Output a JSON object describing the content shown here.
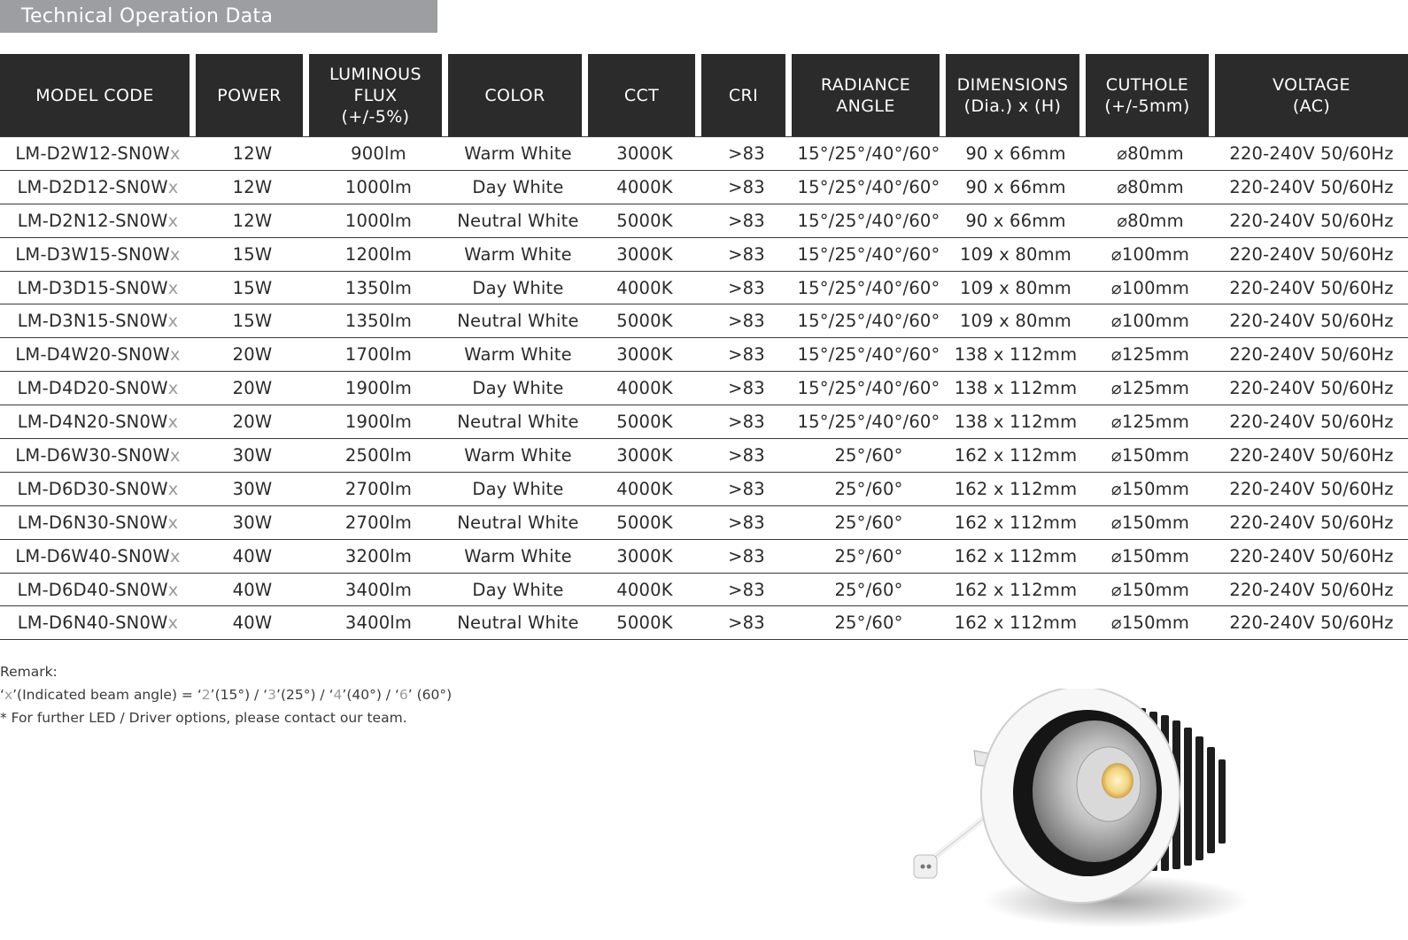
{
  "title": "Technical Operation Data",
  "table": {
    "headers": [
      {
        "line1": "MODEL CODE",
        "line2": "",
        "line3": ""
      },
      {
        "line1": "POWER",
        "line2": "",
        "line3": ""
      },
      {
        "line1": "LUMINOUS",
        "line2": "FLUX",
        "line3": "(+/-5%)"
      },
      {
        "line1": "COLOR",
        "line2": "",
        "line3": ""
      },
      {
        "line1": "CCT",
        "line2": "",
        "line3": ""
      },
      {
        "line1": "CRI",
        "line2": "",
        "line3": ""
      },
      {
        "line1": "RADIANCE",
        "line2": "ANGLE",
        "line3": ""
      },
      {
        "line1": "DIMENSIONS",
        "line2": "(Dia.) x (H)",
        "line3": ""
      },
      {
        "line1": "CUTHOLE",
        "line2": "(+/-5mm)",
        "line3": ""
      },
      {
        "line1": "VOLTAGE",
        "line2": "(AC)",
        "line3": ""
      }
    ],
    "rows": [
      {
        "model": "LM-D2W12-SN0W",
        "suffix": "x",
        "power": "12W",
        "flux": "900lm",
        "color": "Warm White",
        "cct": "3000K",
        "cri": ">83",
        "angle": "15°/25°/40°/60°",
        "dimensions": "90 x 66mm",
        "cuthole": "⌀80mm",
        "voltage": "220-240V 50/60Hz"
      },
      {
        "model": "LM-D2D12-SN0W",
        "suffix": "x",
        "power": "12W",
        "flux": "1000lm",
        "color": "Day White",
        "cct": "4000K",
        "cri": ">83",
        "angle": "15°/25°/40°/60°",
        "dimensions": "90 x 66mm",
        "cuthole": "⌀80mm",
        "voltage": "220-240V 50/60Hz"
      },
      {
        "model": "LM-D2N12-SN0W",
        "suffix": "x",
        "power": "12W",
        "flux": "1000lm",
        "color": "Neutral White",
        "cct": "5000K",
        "cri": ">83",
        "angle": "15°/25°/40°/60°",
        "dimensions": "90 x 66mm",
        "cuthole": "⌀80mm",
        "voltage": "220-240V 50/60Hz"
      },
      {
        "model": "LM-D3W15-SN0W",
        "suffix": "x",
        "power": "15W",
        "flux": "1200lm",
        "color": "Warm White",
        "cct": "3000K",
        "cri": ">83",
        "angle": "15°/25°/40°/60°",
        "dimensions": "109 x 80mm",
        "cuthole": "⌀100mm",
        "voltage": "220-240V 50/60Hz"
      },
      {
        "model": "LM-D3D15-SN0W",
        "suffix": "x",
        "power": "15W",
        "flux": "1350lm",
        "color": "Day White",
        "cct": "4000K",
        "cri": ">83",
        "angle": "15°/25°/40°/60°",
        "dimensions": "109 x 80mm",
        "cuthole": "⌀100mm",
        "voltage": "220-240V 50/60Hz"
      },
      {
        "model": "LM-D3N15-SN0W",
        "suffix": "x",
        "power": "15W",
        "flux": "1350lm",
        "color": "Neutral White",
        "cct": "5000K",
        "cri": ">83",
        "angle": "15°/25°/40°/60°",
        "dimensions": "109 x 80mm",
        "cuthole": "⌀100mm",
        "voltage": "220-240V 50/60Hz"
      },
      {
        "model": "LM-D4W20-SN0W",
        "suffix": "x",
        "power": "20W",
        "flux": "1700lm",
        "color": "Warm White",
        "cct": "3000K",
        "cri": ">83",
        "angle": "15°/25°/40°/60°",
        "dimensions": "138 x 112mm",
        "cuthole": "⌀125mm",
        "voltage": "220-240V 50/60Hz"
      },
      {
        "model": "LM-D4D20-SN0W",
        "suffix": "x",
        "power": "20W",
        "flux": "1900lm",
        "color": "Day White",
        "cct": "4000K",
        "cri": ">83",
        "angle": "15°/25°/40°/60°",
        "dimensions": "138 x 112mm",
        "cuthole": "⌀125mm",
        "voltage": "220-240V 50/60Hz"
      },
      {
        "model": "LM-D4N20-SN0W",
        "suffix": "x",
        "power": "20W",
        "flux": "1900lm",
        "color": "Neutral White",
        "cct": "5000K",
        "cri": ">83",
        "angle": "15°/25°/40°/60°",
        "dimensions": "138 x 112mm",
        "cuthole": "⌀125mm",
        "voltage": "220-240V 50/60Hz"
      },
      {
        "model": "LM-D6W30-SN0W",
        "suffix": "x",
        "power": "30W",
        "flux": "2500lm",
        "color": "Warm White",
        "cct": "3000K",
        "cri": ">83",
        "angle": "25°/60°",
        "dimensions": "162 x 112mm",
        "cuthole": "⌀150mm",
        "voltage": "220-240V 50/60Hz"
      },
      {
        "model": "LM-D6D30-SN0W",
        "suffix": "x",
        "power": "30W",
        "flux": "2700lm",
        "color": "Day White",
        "cct": "4000K",
        "cri": ">83",
        "angle": "25°/60°",
        "dimensions": "162 x 112mm",
        "cuthole": "⌀150mm",
        "voltage": "220-240V 50/60Hz"
      },
      {
        "model": "LM-D6N30-SN0W",
        "suffix": "x",
        "power": "30W",
        "flux": "2700lm",
        "color": "Neutral White",
        "cct": "5000K",
        "cri": ">83",
        "angle": "25°/60°",
        "dimensions": "162 x 112mm",
        "cuthole": "⌀150mm",
        "voltage": "220-240V 50/60Hz"
      },
      {
        "model": "LM-D6W40-SN0W",
        "suffix": "x",
        "power": "40W",
        "flux": "3200lm",
        "color": "Warm White",
        "cct": "3000K",
        "cri": ">83",
        "angle": "25°/60°",
        "dimensions": "162 x 112mm",
        "cuthole": "⌀150mm",
        "voltage": "220-240V 50/60Hz"
      },
      {
        "model": "LM-D6D40-SN0W",
        "suffix": "x",
        "power": "40W",
        "flux": "3400lm",
        "color": "Day White",
        "cct": "4000K",
        "cri": ">83",
        "angle": "25°/60°",
        "dimensions": "162 x 112mm",
        "cuthole": "⌀150mm",
        "voltage": "220-240V 50/60Hz"
      },
      {
        "model": "LM-D6N40-SN0W",
        "suffix": "x",
        "power": "40W",
        "flux": "3400lm",
        "color": "Neutral White",
        "cct": "5000K",
        "cri": ">83",
        "angle": "25°/60°",
        "dimensions": "162 x 112mm",
        "cuthole": "⌀150mm",
        "voltage": "220-240V 50/60Hz"
      }
    ]
  },
  "remarks": {
    "heading": "Remark:",
    "beam": {
      "q1": "‘",
      "x": "x",
      "lbl": "’(Indicated beam angle)  =  ‘",
      "n2": "2",
      "t2": "’(15°)  / ‘",
      "n3": "3",
      "t3": "’(25°)  / ‘",
      "n4": "4",
      "t4": "’(40°)  / ‘",
      "n6": "6",
      "t6": "’ (60°)"
    },
    "note": "* For further LED / Driver options, please contact our team."
  },
  "colors": {
    "title_bar": "#9d9ea2",
    "header_bg": "#2b2b2b",
    "header_text": "#ffffff",
    "body_text": "#2a2a2a",
    "suffix_gray": "#9a9a9a"
  },
  "product_image": {
    "icon": "led-downlight-photo"
  }
}
